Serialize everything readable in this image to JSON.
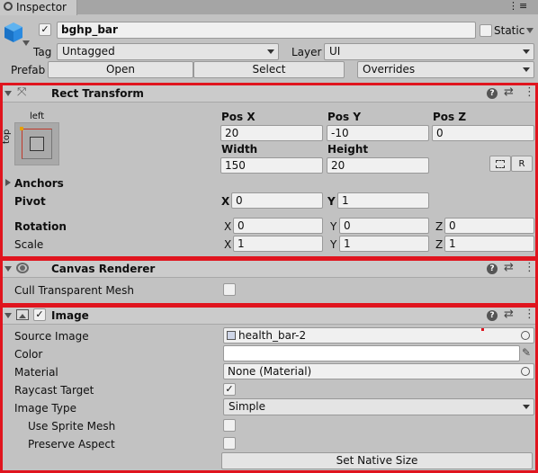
{
  "tab": {
    "title": "Inspector"
  },
  "object": {
    "name": "bghp_bar",
    "active": true,
    "static_label": "Static",
    "tag_label": "Tag",
    "tag_value": "Untagged",
    "layer_label": "Layer",
    "layer_value": "UI",
    "prefab_label": "Prefab",
    "prefab_open": "Open",
    "prefab_select": "Select",
    "prefab_overrides": "Overrides"
  },
  "rect_transform": {
    "title": "Rect Transform",
    "anchor_h": "left",
    "anchor_v": "top",
    "pos_x_label": "Pos X",
    "pos_y_label": "Pos Y",
    "pos_z_label": "Pos Z",
    "pos_x": "20",
    "pos_y": "-10",
    "pos_z": "0",
    "width_label": "Width",
    "height_label": "Height",
    "width": "150",
    "height": "20",
    "r_button": "R",
    "anchors_label": "Anchors",
    "pivot_label": "Pivot",
    "pivot_x": "0",
    "pivot_y": "1",
    "rotation_label": "Rotation",
    "rotation_x": "0",
    "rotation_y": "0",
    "rotation_z": "0",
    "scale_label": "Scale",
    "scale_x": "1",
    "scale_y": "1",
    "scale_z": "1",
    "x": "X",
    "y": "Y",
    "z": "Z"
  },
  "canvas_renderer": {
    "title": "Canvas Renderer",
    "cull_label": "Cull Transparent Mesh",
    "cull_checked": false
  },
  "image": {
    "title": "Image",
    "enabled": true,
    "source_image_label": "Source Image",
    "source_image_value": "health_bar-2",
    "color_label": "Color",
    "color_value": "#ffffff",
    "material_label": "Material",
    "material_value": "None (Material)",
    "raycast_label": "Raycast Target",
    "raycast_checked": true,
    "image_type_label": "Image Type",
    "image_type_value": "Simple",
    "use_sprite_mesh_label": "Use Sprite Mesh",
    "preserve_aspect_label": "Preserve Aspect",
    "set_native_size": "Set Native Size"
  },
  "colors": {
    "highlight": "#e0141e",
    "panel": "#c2c2c2",
    "field": "#f0f0f0"
  }
}
